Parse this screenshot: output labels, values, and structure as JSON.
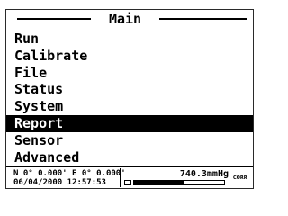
{
  "screen": {
    "title": "Main",
    "menu": [
      {
        "label": "Run",
        "selected": false
      },
      {
        "label": "Calibrate",
        "selected": false
      },
      {
        "label": "File",
        "selected": false
      },
      {
        "label": "Status",
        "selected": false
      },
      {
        "label": "System",
        "selected": false
      },
      {
        "label": "Report",
        "selected": true
      },
      {
        "label": "Sensor",
        "selected": false
      },
      {
        "label": "Advanced",
        "selected": false
      }
    ]
  },
  "status_bar": {
    "coordinates": "N 0° 0.000' E 0° 0.000'",
    "datetime": "06/04/2000 12:57:53",
    "pressure": "740.3mmHg",
    "corr_label": "CORR",
    "battery_level": 0.55
  }
}
